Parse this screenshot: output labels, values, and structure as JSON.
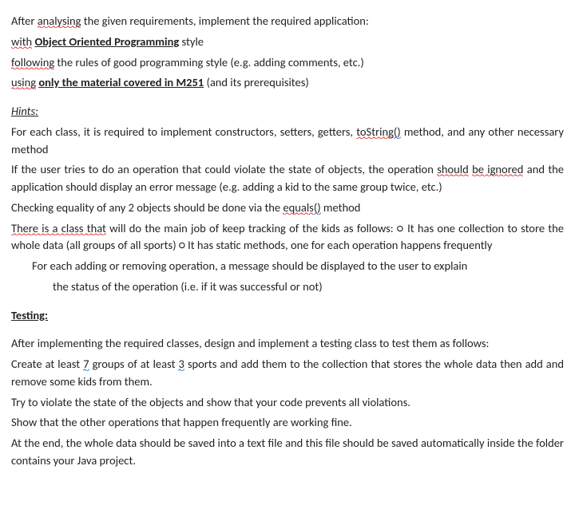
{
  "intro": {
    "line1_a": "After ",
    "line1_b": "analysing",
    "line1_c": " the given requirements, implement the required application:",
    "line2_a": "with",
    "line2_b": " ",
    "line2_c": "Object Oriented Programming",
    "line2_d": " style",
    "line3_a": "following",
    "line3_b": " the rules of good programming style (e.g. adding comments, etc.)",
    "line4_a": "using",
    "line4_b": " ",
    "line4_c": "only the material covered in M251",
    "line4_d": " (and its prerequisites)"
  },
  "hints": {
    "heading": "Hints:",
    "p1_a": "For each class, it is required to implement constructors, setters, getters, ",
    "p1_b": "toString",
    "p1_c": "()",
    "p1_d": " method, and any other necessary method",
    "p2_a": "If the user tries to do an operation that could violate the state of objects, the operation ",
    "p2_b": "should",
    "p2_b2": " ",
    "p2_c": "be ignored",
    "p2_d": " and the application should display an error message (e.g. adding a kid to the same group twice, etc.)",
    "p3_a": "Checking equality of any 2 objects should be done via the ",
    "p3_b": "equals",
    "p3_c": "()",
    "p3_d": " method",
    "p4_a": "There is a class that",
    "p4_b": " will do the main job of keep tracking of the kids as follows: ○ It has one collection to store the whole data (all groups of all sports) ○ It has static methods, one for each operation happens frequently",
    "p5": "For each adding or removing operation, a message should be displayed to the user to explain",
    "p6": "the status of the operation (i.e. if it was successful or not)"
  },
  "testing": {
    "heading": "Testing:",
    "p1": "After implementing the required classes, design and implement a testing class to test them as follows:",
    "p2_a": "Create at least ",
    "p2_a2": "7",
    "p2_b": " groups of at least ",
    "p2_b2": "3",
    "p2_c": " sports and add them to the collection that stores the whole data then add and remove some kids from them.",
    "p3": "Try to violate the state of the objects and show that your code prevents all violations.",
    "p4": "Show that the other operations that happen frequently are working fine.",
    "p5": "At the end, the whole data should be saved into a text file and this file should be saved automatically inside the folder contains your Java project."
  }
}
